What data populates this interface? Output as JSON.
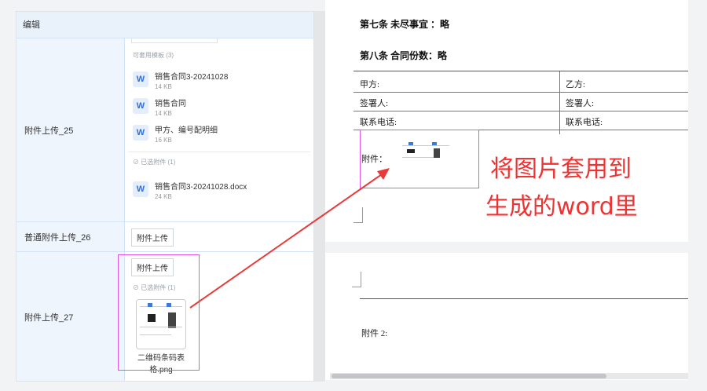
{
  "left": {
    "header": "编辑",
    "rows": {
      "r25": {
        "label": "附件上传_25",
        "avail_header": "可套用模板 (3)",
        "files": [
          {
            "name": "销售合同3-20241028",
            "size": "14 KB"
          },
          {
            "name": "销售合同",
            "size": "14 KB"
          },
          {
            "name": "甲方、编号配明细",
            "size": "16 KB"
          }
        ],
        "selected_header": "已选附件 (1)",
        "selected": {
          "name": "销售合同3-20241028.docx",
          "size": "24 KB"
        }
      },
      "r26": {
        "label": "普通附件上传_26",
        "button": "附件上传"
      },
      "r27": {
        "label": "附件上传_27",
        "button": "附件上传",
        "selected_header": "已选附件 (1)",
        "image_name": "二维码条码表格.png"
      }
    }
  },
  "doc": {
    "article7": "第七条 未尽事宜 ：略",
    "article8": "第八条 合同份数：略",
    "table": [
      {
        "a": "甲方:",
        "b": "乙方:"
      },
      {
        "a": "签署人:",
        "b": "签署人:"
      },
      {
        "a": "联系电话:",
        "b": "联系电话:"
      }
    ],
    "attachment": "附件：",
    "attachment2": "附件 2:"
  },
  "annotation": {
    "line1": "将图片套用到",
    "line2": "生成的word里"
  },
  "colors": {
    "annotation": "#e33333",
    "highlight_box": "#e055e6",
    "arrow": "#e83a3a"
  }
}
